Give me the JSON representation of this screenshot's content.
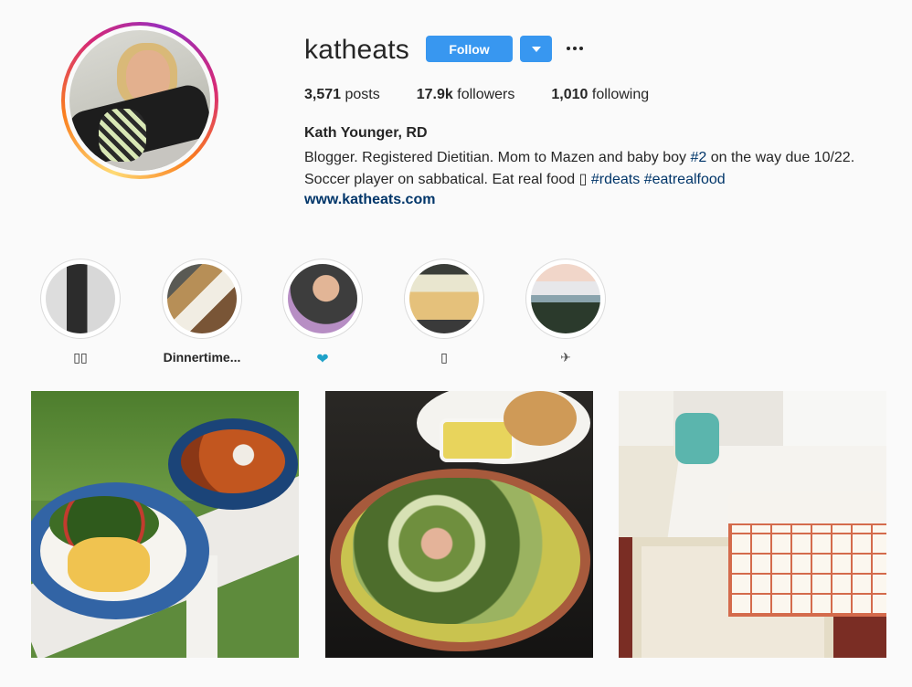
{
  "profile": {
    "username": "katheats",
    "follow_label": "Follow",
    "stats": {
      "posts_count": "3,571",
      "posts_label": "posts",
      "followers_count": "17.9k",
      "followers_label": "followers",
      "following_count": "1,010",
      "following_label": "following"
    },
    "full_name": "Kath Younger, RD",
    "bio_line1_pre": "Blogger. Registered Dietitian. Mom to Mazen and baby boy ",
    "bio_line1_tag": "#2",
    "bio_line1_post": " on the way due 10/22.",
    "bio_line2_pre": "Soccer player on sabbatical. Eat real food ▯ ",
    "bio_tag_rdeats": "#rdeats",
    "bio_tag_eatrealfood": "#eatrealfood",
    "website": "www.katheats.com"
  },
  "highlights": [
    {
      "label": "▯▯"
    },
    {
      "label": "Dinnertime..."
    },
    {
      "label": "❤",
      "icon": "heart-icon"
    },
    {
      "label": "▯"
    },
    {
      "label": "✈",
      "icon": "airplane-icon"
    }
  ],
  "colors": {
    "accent": "#3897f0",
    "link": "#003569",
    "heart": "#1ea1c8"
  }
}
